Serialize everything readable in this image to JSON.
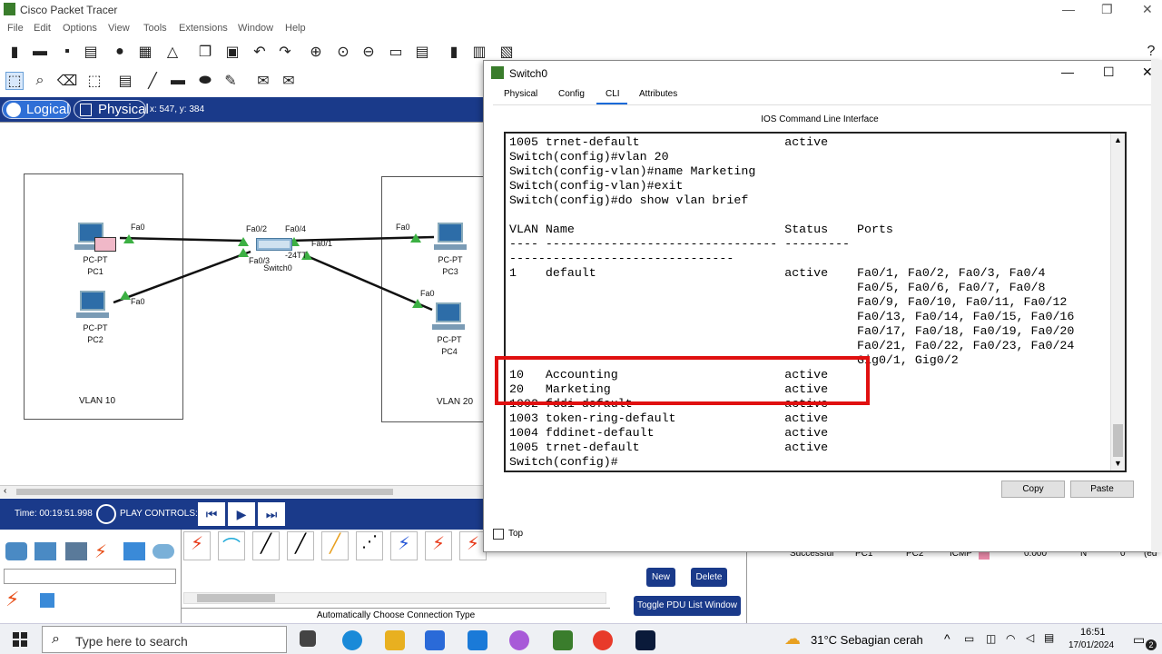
{
  "app": {
    "title": "Cisco Packet Tracer"
  },
  "menu": [
    "File",
    "Edit",
    "Options",
    "View",
    "Tools",
    "Extensions",
    "Window",
    "Help"
  ],
  "modes": {
    "logical": "Logical",
    "physical": "Physical",
    "coords": "x: 547, y: 384"
  },
  "topology": {
    "vlan10_label": "VLAN 10",
    "vlan20_label": "VLAN 20",
    "pc1": {
      "type": "PC-PT",
      "name": "PC1"
    },
    "pc2": {
      "type": "PC-PT",
      "name": "PC2"
    },
    "pc3": {
      "type": "PC-PT",
      "name": "PC3"
    },
    "pc4": {
      "type": "PC-PT",
      "name": "PC4"
    },
    "switch": {
      "model": "-24TT",
      "name": "Switch0"
    },
    "ports": {
      "pc1": "Fa0",
      "pc2": "Fa0",
      "pc3": "Fa0",
      "pc4": "Fa0",
      "sw_02": "Fa0/2",
      "sw_03": "Fa0/3",
      "sw_04": "Fa0/4",
      "sw_01": "Fa0/1"
    }
  },
  "timebar": {
    "time": "Time: 00:19:51.998",
    "play_controls": "PLAY CONTROLS:"
  },
  "connection": {
    "auto_label": "Automatically Choose Connection Type"
  },
  "pdu": {
    "new_label": "New",
    "delete_label": "Delete",
    "toggle_label": "Toggle PDU List Window",
    "row": {
      "status": "Successful",
      "source": "PC1",
      "destination": "PC2",
      "type": "ICMP",
      "time": "0.000",
      "periodic": "N",
      "num": "0",
      "edit": "(ed"
    }
  },
  "dialog": {
    "title": "Switch0",
    "tabs": [
      "Physical",
      "Config",
      "CLI",
      "Attributes"
    ],
    "active_tab": "CLI",
    "ios_label": "IOS Command Line Interface",
    "copy_label": "Copy",
    "paste_label": "Paste",
    "top_label": "Top",
    "terminal_lines": [
      "1005 trnet-default                    active",
      "Switch(config)#vlan 20",
      "Switch(config-vlan)#name Marketing",
      "Switch(config-vlan)#exit",
      "Switch(config)#do show vlan brief",
      "",
      "VLAN Name                             Status    Ports",
      "---- -------------------------------- ---------",
      "-------------------------------",
      "1    default                          active    Fa0/1, Fa0/2, Fa0/3, Fa0/4",
      "                                                Fa0/5, Fa0/6, Fa0/7, Fa0/8",
      "                                                Fa0/9, Fa0/10, Fa0/11, Fa0/12",
      "                                                Fa0/13, Fa0/14, Fa0/15, Fa0/16",
      "                                                Fa0/17, Fa0/18, Fa0/19, Fa0/20",
      "                                                Fa0/21, Fa0/22, Fa0/23, Fa0/24",
      "                                                Gig0/1, Gig0/2",
      "10   Accounting                       active",
      "20   Marketing                        active",
      "1002 fddi-default                     active",
      "1003 token-ring-default               active",
      "1004 fddinet-default                  active",
      "1005 trnet-default                    active",
      "Switch(config)#"
    ]
  },
  "taskbar": {
    "search_placeholder": "Type here to search",
    "weather": "31°C  Sebagian cerah",
    "time": "16:51",
    "date": "17/01/2024",
    "notifications": "2"
  },
  "colors": {
    "accent_blue": "#1a3a8a",
    "highlight_red": "#e01010",
    "cable_green": "#3cb043"
  }
}
